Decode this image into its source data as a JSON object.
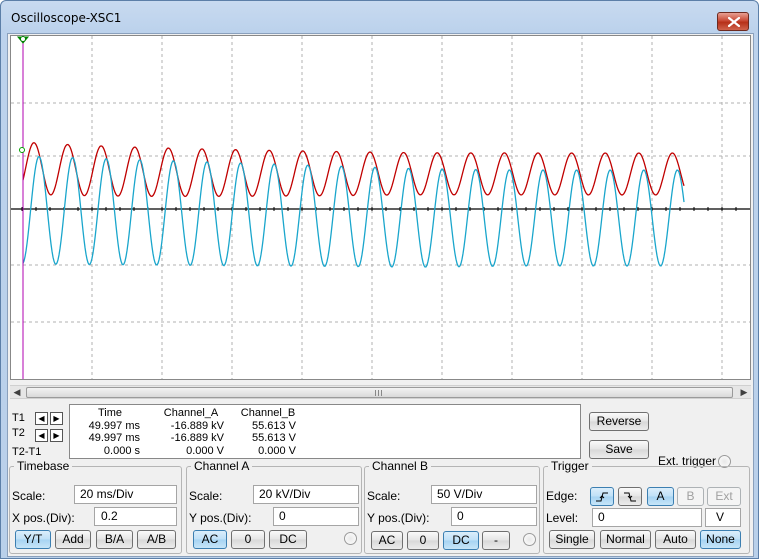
{
  "window": {
    "title": "Oscilloscope-XSC1"
  },
  "colors": {
    "channel_a": "#c00000",
    "channel_b": "#1aa6cc",
    "trigger": "#b000b0",
    "ground_marker": "#00a000"
  },
  "cursors": {
    "t1_label": "T1",
    "t2_label": "T2",
    "delta_label": "T2-T1"
  },
  "readout": {
    "headers": {
      "time": "Time",
      "channel_a": "Channel_A",
      "channel_b": "Channel_B"
    },
    "rows": [
      {
        "time": "49.997 ms",
        "channel_a": "-16.889 kV",
        "channel_b": "55.613 V"
      },
      {
        "time": "49.997 ms",
        "channel_a": "-16.889 kV",
        "channel_b": "55.613 V"
      },
      {
        "time": "0.000 s",
        "channel_a": "0.000 V",
        "channel_b": "0.000 V"
      }
    ]
  },
  "buttons": {
    "reverse": "Reverse",
    "save": "Save",
    "ext_trigger": "Ext. trigger"
  },
  "timebase": {
    "title": "Timebase",
    "scale_label": "Scale:",
    "scale_value": "20 ms/Div",
    "xpos_label": "X pos.(Div):",
    "xpos_value": "0.2",
    "modes": [
      "Y/T",
      "Add",
      "B/A",
      "A/B"
    ]
  },
  "channel_a": {
    "title": "Channel A",
    "scale_label": "Scale:",
    "scale_value": "20 kV/Div",
    "ypos_label": "Y pos.(Div):",
    "ypos_value": "0",
    "coupling": [
      "AC",
      "0",
      "DC"
    ]
  },
  "channel_b": {
    "title": "Channel B",
    "scale_label": "Scale:",
    "scale_value": "50  V/Div",
    "ypos_label": "Y pos.(Div):",
    "ypos_value": "0",
    "coupling": [
      "AC",
      "0",
      "DC",
      "-"
    ]
  },
  "trigger": {
    "title": "Trigger",
    "edge_label": "Edge:",
    "sources": [
      "A",
      "B",
      "Ext"
    ],
    "level_label": "Level:",
    "level_value": "0",
    "level_unit": "V",
    "modes": [
      "Single",
      "Normal",
      "Auto",
      "None"
    ]
  }
}
